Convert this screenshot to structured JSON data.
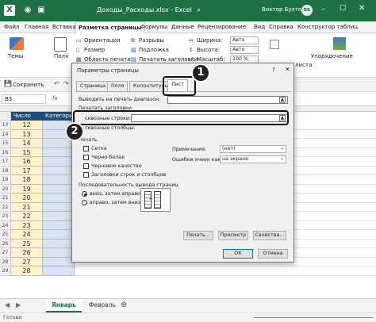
{
  "titlebar": {
    "title": "Доходы_Расходы.xlsx  -  Excel",
    "user": "Виктор Бухтеев",
    "user_initials": "ВБ"
  },
  "menu": [
    "Файл",
    "Главная",
    "Вставка",
    "Разметка страницы",
    "Формулы",
    "Данные",
    "Рецензирование",
    "Вид",
    "Справка",
    "Конструктор таблиц"
  ],
  "ribbon": {
    "themes": "Темы",
    "fields": "Поля",
    "orientation": "Ориентация",
    "size": "Размер",
    "print_area": "Область печати",
    "breaks": "Разрывы",
    "background": "Подложка",
    "print_titles": "Печатать заголовки",
    "width_label": "Ширина:",
    "width_value": "Авто",
    "height_label": "Высота:",
    "height_value": "Авто",
    "scale_label": "Масштаб:",
    "scale_value": "100 %",
    "sheet_options": "Параметры листа",
    "arrange": "Упорядочение"
  },
  "qat": {
    "save": "Сохранить"
  },
  "formulabar": {
    "namebox": "B3",
    "fx": "fx"
  },
  "sheet": {
    "col_a_header": "Число",
    "col_b_header": "Категори",
    "rows": [
      {
        "num": "13",
        "val": "12"
      },
      {
        "num": "14",
        "val": "13"
      },
      {
        "num": "15",
        "val": "14"
      },
      {
        "num": "16",
        "val": "15"
      },
      {
        "num": "17",
        "val": "16"
      },
      {
        "num": "18",
        "val": "17"
      },
      {
        "num": "19",
        "val": "18"
      },
      {
        "num": "20",
        "val": "19"
      },
      {
        "num": "21",
        "val": "20"
      },
      {
        "num": "22",
        "val": "21"
      },
      {
        "num": "23",
        "val": "22"
      },
      {
        "num": "24",
        "val": "23"
      },
      {
        "num": "25",
        "val": "24"
      },
      {
        "num": "26",
        "val": "25"
      },
      {
        "num": "27",
        "val": "26"
      },
      {
        "num": "28",
        "val": "27"
      },
      {
        "num": "29",
        "val": "28"
      }
    ]
  },
  "tabs": {
    "sheet1": "Январь",
    "sheet2": "Февраль"
  },
  "status": {
    "ready": "Готово"
  },
  "dialog": {
    "title": "Параметры страницы",
    "help": "?",
    "tabs": [
      "Страница",
      "Поля",
      "Колонтитулы",
      "Лист"
    ],
    "print_range": "Выводить на печать диапазон:",
    "print_titles": "Печатать заголовки",
    "rows_label": "сквозные строки:",
    "cols_label": "сквозные столбцы:",
    "print_section": "Печать",
    "grid": "Сетка",
    "bw": "Черно-белая",
    "draft": "Черновое качество",
    "headings": "Заголовки строк и столбцов",
    "comments_label": "Примечания:",
    "comments_value": "(нет)",
    "errors_label": "Ошибки ячеек как:",
    "errors_value": "на экране",
    "order_section": "Последовательность вывода страниц",
    "order_down": "вниз, затем вправо",
    "order_over": "вправо, затем вниз",
    "print_btn": "Печать...",
    "preview_btn": "Просмотр",
    "props_btn": "Свойства...",
    "ok_btn": "ОК",
    "cancel_btn": "Отмена"
  },
  "callouts": {
    "one": "1",
    "two": "2"
  },
  "colors": {
    "excel_green": "#1e7145",
    "cell_yellow": "#fff2cc",
    "cell_blue": "#dae3f3",
    "callout": "#222222"
  }
}
